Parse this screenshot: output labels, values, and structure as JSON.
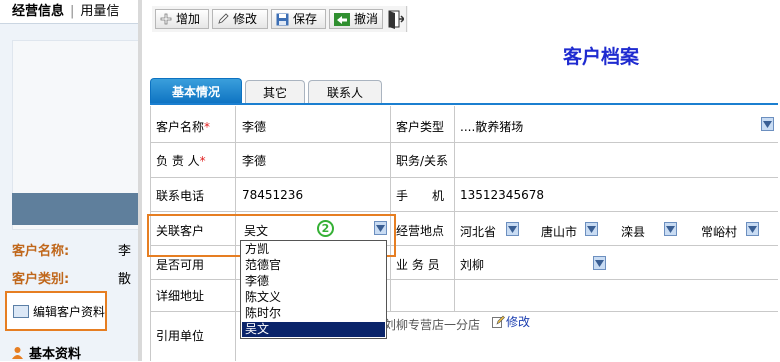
{
  "left": {
    "topbar": {
      "item1": "经营信息",
      "item2": "用量信"
    },
    "customer_name_label": "客户名称:",
    "customer_name_value": "李",
    "customer_type_label": "客户类别:",
    "customer_type_value": "散",
    "edit_button": "编辑客户资料",
    "section_title": "基本资料"
  },
  "toolbar": {
    "add": "增加",
    "edit": "修改",
    "save": "保存",
    "cancel": "撤消"
  },
  "page_title": "客户档案",
  "tabs": [
    "基本情况",
    "其它",
    "联系人"
  ],
  "form": {
    "customer_name": {
      "label": "客户名称",
      "value": "李德"
    },
    "customer_type": {
      "label": "客户类型",
      "value": "....散养猪场"
    },
    "person_in_charge": {
      "label": "负 责 人",
      "value": "李德"
    },
    "position": {
      "label": "职务/关系",
      "value": ""
    },
    "phone": {
      "label": "联系电话",
      "value": "78451236"
    },
    "mobile": {
      "label": "手　　机",
      "value": "13512345678"
    },
    "related_customer": {
      "label": "关联客户",
      "value": "吴文",
      "badge": "2"
    },
    "location": {
      "label": "经营地点",
      "province": "河北省",
      "city": "唐山市",
      "county": "滦县",
      "village": "常峪村"
    },
    "enabled": {
      "label": "是否可用"
    },
    "salesman": {
      "label": "业 务 员",
      "value": "刘柳"
    },
    "address": {
      "label": "详细地址"
    },
    "reference_unit": {
      "label": "引用单位",
      "value": "刘柳专营店一分店",
      "edit_link": "修改"
    }
  },
  "dropdown": {
    "options": [
      "方凯",
      "范德官",
      "李德",
      "陈文义",
      "陈时尔",
      "吴文"
    ],
    "selected": "吴文"
  },
  "colors": {
    "accent_orange": "#e67e22",
    "title_blue": "#1f2bd0",
    "tab_blue": "#0d72c1",
    "selection": "#0a246a"
  }
}
